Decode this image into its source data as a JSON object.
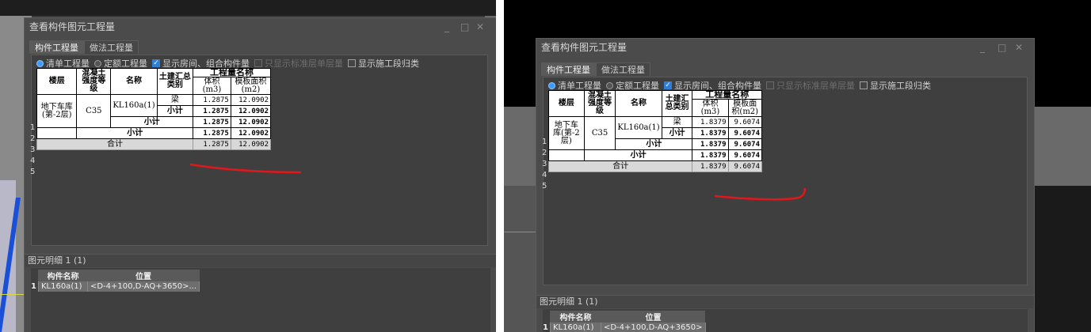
{
  "colors": {
    "window_bg": "#4b4b4b",
    "accent_radio": "#3b9cff",
    "checkbox": "#2f7fd8",
    "annotation": "#e0181c",
    "table_bg": "#ffffff"
  },
  "window": {
    "title": "查看构件图元工程量",
    "controls": [
      "_",
      "□",
      "✕"
    ]
  },
  "tabs": [
    {
      "label": "构件工程量",
      "active": true
    },
    {
      "label": "做法工程量",
      "active": false
    }
  ],
  "options": {
    "radio_list": "清单工程量",
    "radio_quota": "定额工程量",
    "show_rooms": "显示房间、组合构件量",
    "show_std_floor": "只显示标准层单层量",
    "show_stage": "显示施工段归类"
  },
  "table_headers": {
    "floor": "楼层",
    "grade": "混凝土强度等级",
    "name": "名称",
    "category": "土建汇总类别",
    "qty_name": "工程量名称",
    "volume": "体积(m3)",
    "formwork": "模板面积(m2)"
  },
  "row_numbers": [
    "1",
    "2",
    "3",
    "4",
    "5"
  ],
  "row_common": {
    "floor": "地下车库(第-2层)",
    "grade": "C35",
    "member": "KL160a(1)",
    "cat_beam": "梁",
    "subtotal": "小计",
    "total": "合计"
  },
  "left": {
    "vol_beam": "1.2875",
    "form_beam": "12.0902",
    "vol_sub1": "1.2875",
    "form_sub1": "12.0902",
    "vol_sub2": "1.2875",
    "form_sub2": "12.0902",
    "vol_sub3": "1.2875",
    "form_sub3": "12.0902",
    "vol_total": "1.2875",
    "form_total": "12.0902"
  },
  "right": {
    "vol_beam": "1.8379",
    "form_beam": "9.6074",
    "vol_sub1": "1.8379",
    "form_sub1": "9.6074",
    "vol_sub2": "1.8379",
    "form_sub2": "9.6074",
    "vol_sub3": "1.8379",
    "form_sub3": "9.6074",
    "vol_total": "1.8379",
    "form_total": "9.6074"
  },
  "detail": {
    "title": "图元明细",
    "count": "1 (1)",
    "col_name": "构件名称",
    "col_pos": "位置",
    "row_idx": "1",
    "row_name": "KL160a(1)",
    "row_pos_left": "<D-4+100,D-AQ+3650>...",
    "row_pos_right": "<D-4+100,D-AQ+3650>"
  }
}
